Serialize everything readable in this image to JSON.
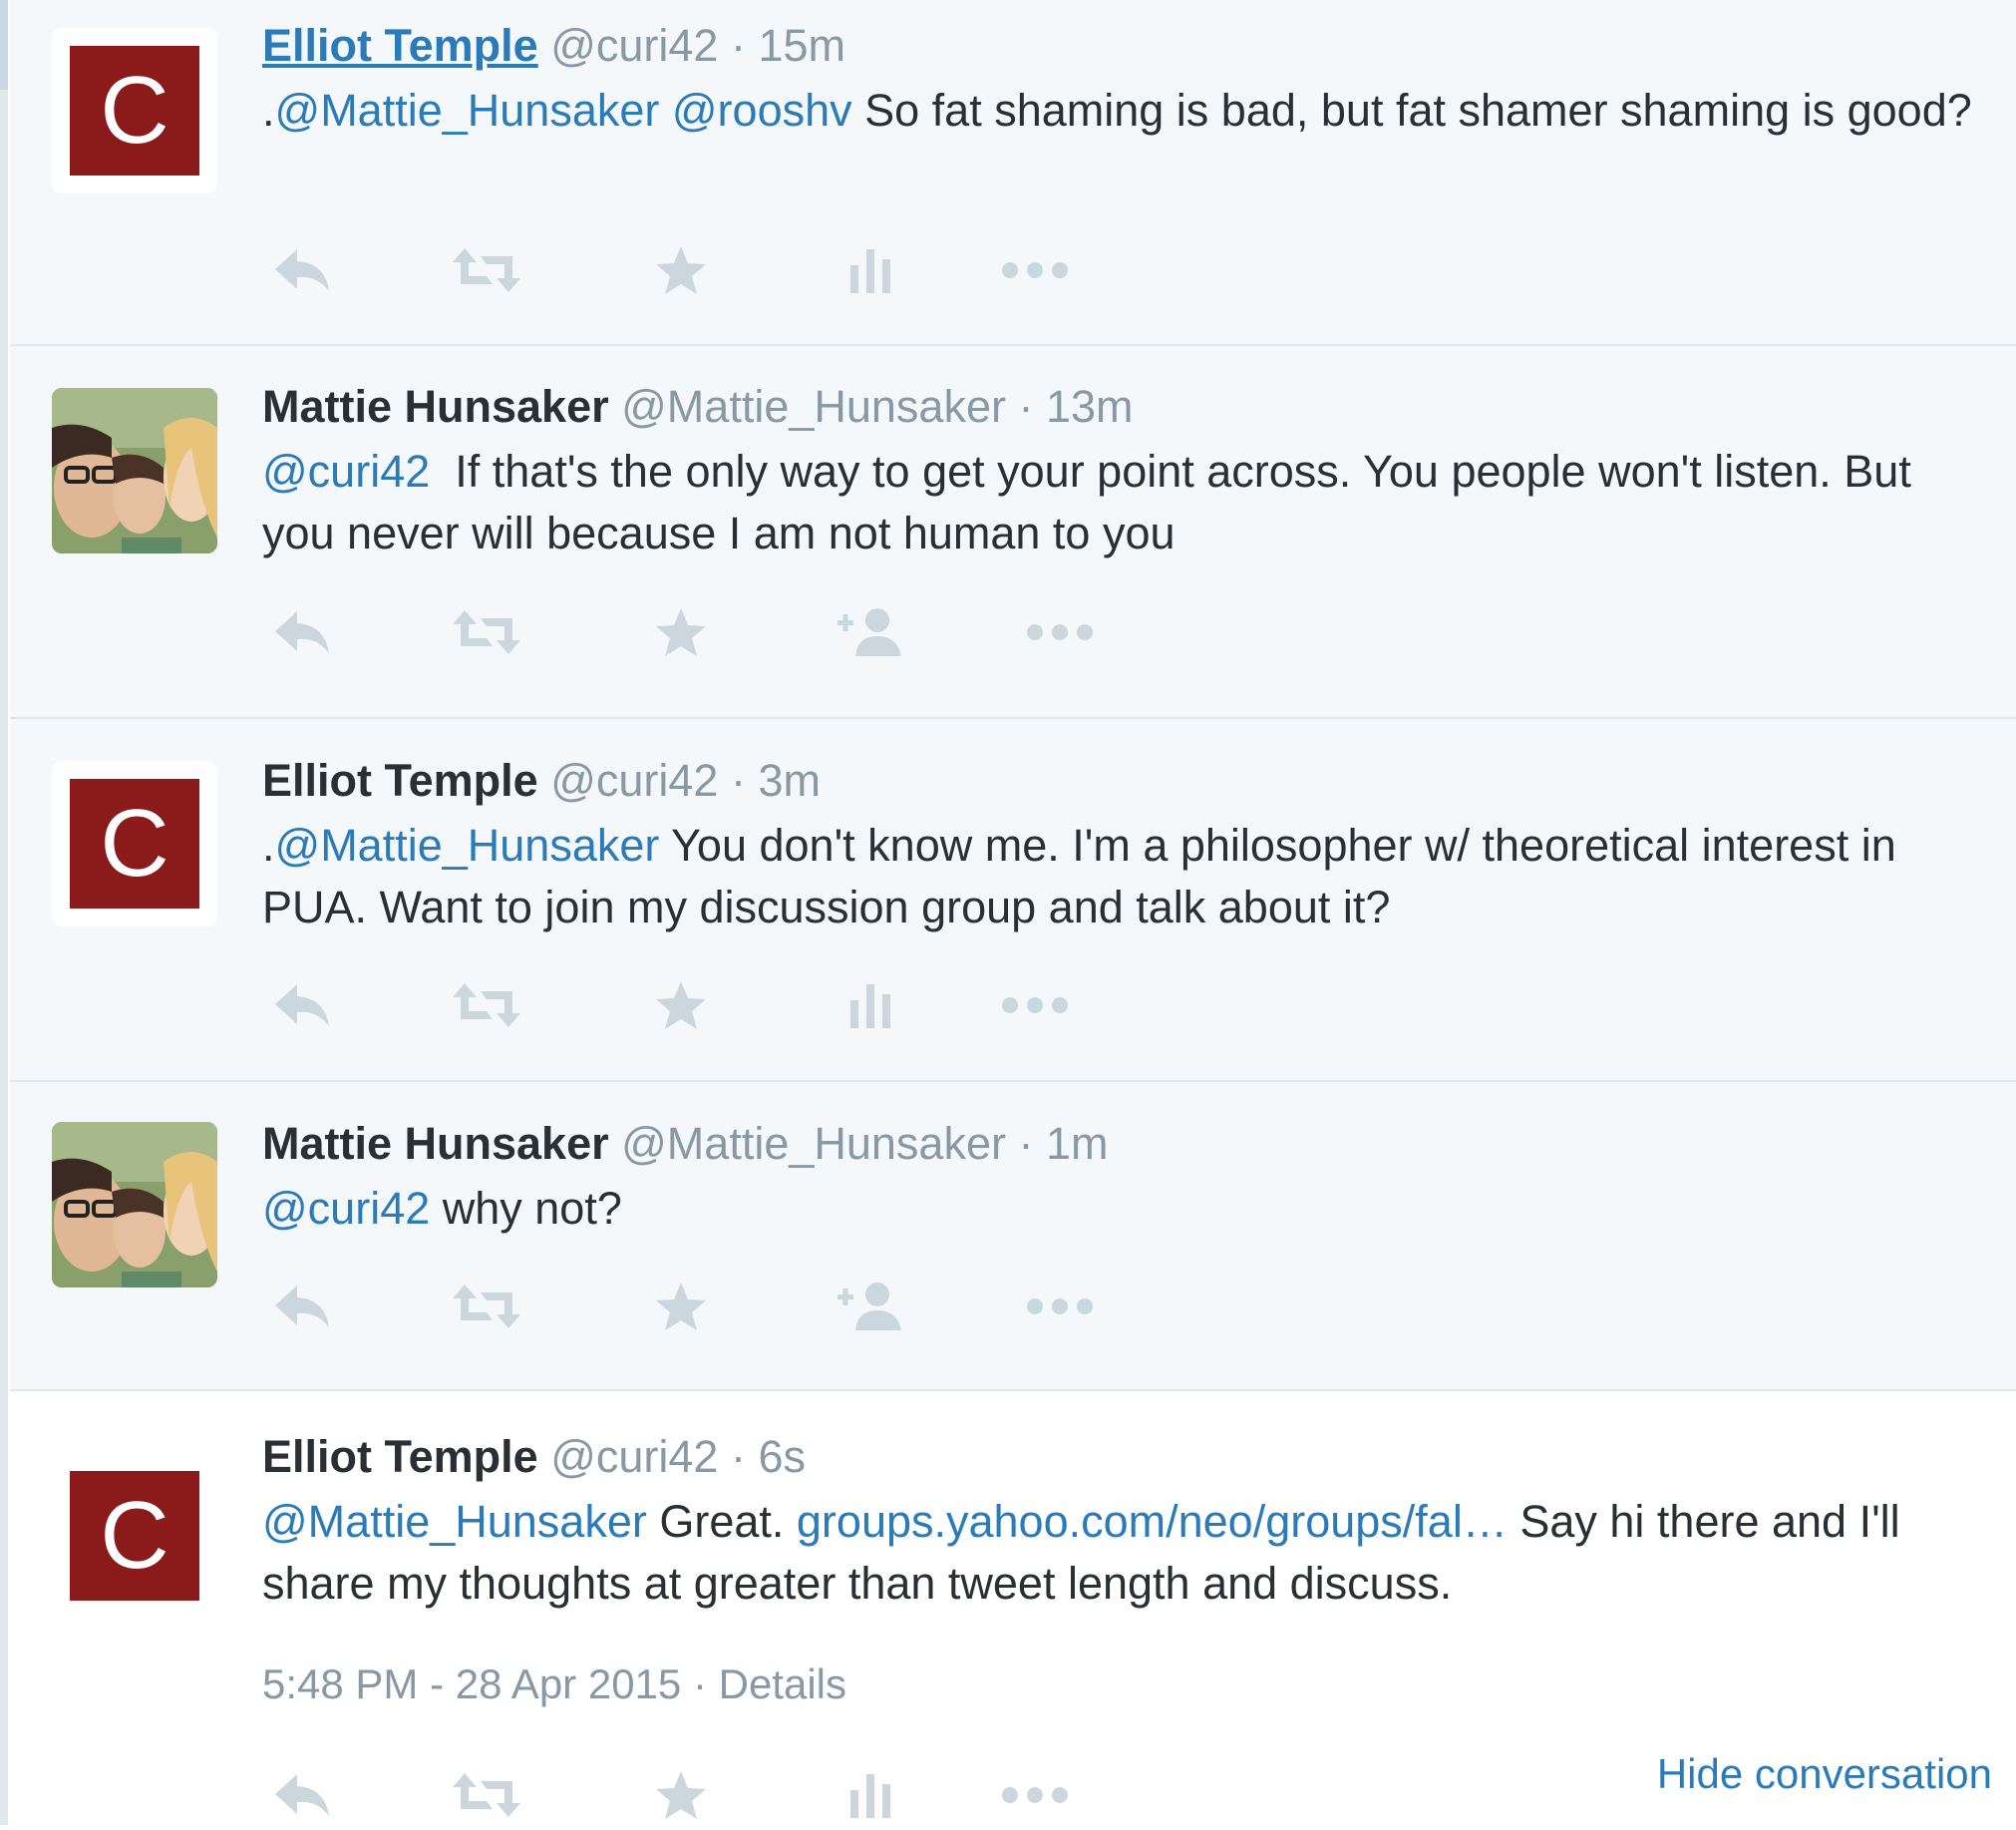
{
  "colors": {
    "link": "#2b7bb9",
    "muted": "#8899a6",
    "text": "#292f33",
    "thread_bg": "#f5f8fa",
    "logo_bg": "#8b1a1a",
    "icon": "#ccd6dd"
  },
  "tweets": [
    {
      "avatar_letter": "C",
      "fullname": "Elliot Temple",
      "handle": "@curi42",
      "dot": "·",
      "time": "15m",
      "text_parts": [
        ".",
        "@Mattie_Hunsaker",
        " ",
        "@rooshv",
        " So fat shaming is bad, but fat shamer shaming is good?"
      ],
      "icons": [
        "reply-icon",
        "retweet-icon",
        "favorite-icon",
        "analytics-icon",
        "more-icon"
      ]
    },
    {
      "avatar_letter": "",
      "fullname": "Mattie Hunsaker",
      "handle": "@Mattie_Hunsaker",
      "dot": "·",
      "time": "13m",
      "text_parts": [
        "@curi42",
        "  If that's the only way to get your point across. You people won't listen. But you never will because I am not human to you"
      ],
      "icons": [
        "reply-icon",
        "retweet-icon",
        "favorite-icon",
        "follow-icon",
        "more-icon"
      ]
    },
    {
      "avatar_letter": "C",
      "fullname": "Elliot Temple",
      "handle": "@curi42",
      "dot": "·",
      "time": "3m",
      "text_parts": [
        ".",
        "@Mattie_Hunsaker",
        " You don't know me. I'm a philosopher w/ theoretical interest in PUA. Want to join my discussion group and talk about it?"
      ],
      "icons": [
        "reply-icon",
        "retweet-icon",
        "favorite-icon",
        "analytics-icon",
        "more-icon"
      ]
    },
    {
      "avatar_letter": "",
      "fullname": "Mattie Hunsaker",
      "handle": "@Mattie_Hunsaker",
      "dot": "·",
      "time": "1m",
      "text_parts": [
        "@curi42",
        " why not?"
      ],
      "icons": [
        "reply-icon",
        "retweet-icon",
        "favorite-icon",
        "follow-icon",
        "more-icon"
      ]
    },
    {
      "avatar_letter": "C",
      "fullname": "Elliot Temple",
      "handle": "@curi42",
      "dot": "·",
      "time": "6s",
      "text_parts": [
        "@Mattie_Hunsaker",
        " Great. ",
        "groups.yahoo.com/neo/groups/fal…",
        " Say hi there and I'll share my thoughts at greater than tweet length and discuss."
      ],
      "timestamp": "5:48 PM - 28 Apr 2015",
      "details_sep": " · ",
      "details": "Details",
      "hide_conversation": "Hide conversation",
      "icons": [
        "reply-icon",
        "retweet-icon",
        "favorite-icon",
        "analytics-icon",
        "more-icon"
      ]
    }
  ]
}
